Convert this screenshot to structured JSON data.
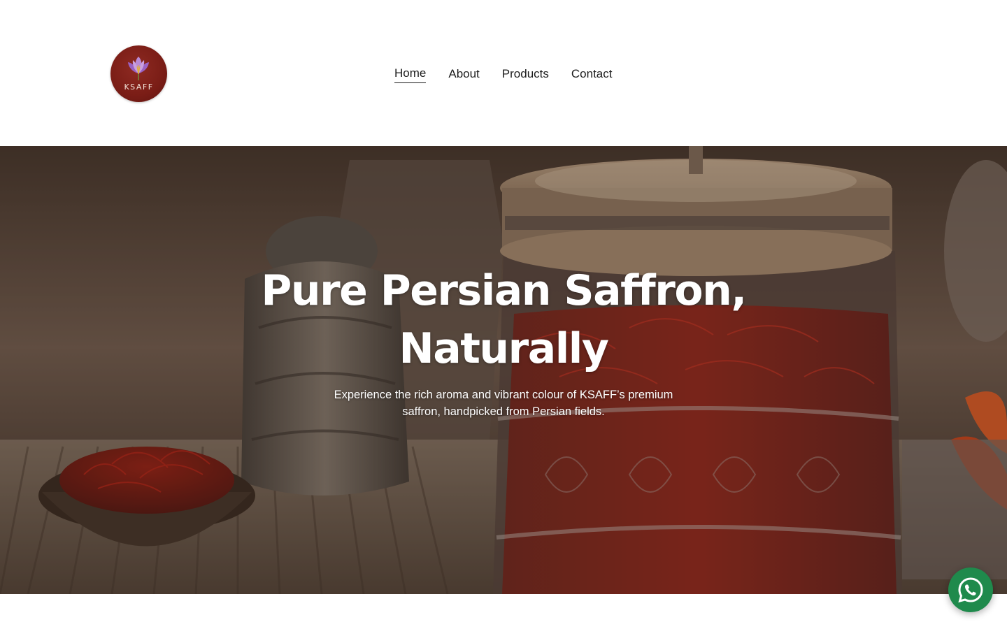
{
  "brand": {
    "logo_text": "KSAFF",
    "logo_color": "#7a1d16",
    "logo_icon": "saffron-crocus-icon"
  },
  "nav": {
    "items": [
      {
        "label": "Home",
        "active": true
      },
      {
        "label": "About",
        "active": false
      },
      {
        "label": "Products",
        "active": false
      },
      {
        "label": "Contact",
        "active": false
      }
    ]
  },
  "hero": {
    "title": "Pure Persian Saffron, Naturally",
    "subtitle": "Experience the rich aroma and vibrant colour of KSAFF’s premium saffron, handpicked from Persian fields.",
    "background": "saffron jar and bowl of saffron threads photo"
  },
  "floating": {
    "whatsapp_icon": "whatsapp-icon",
    "whatsapp_color": "#1f8a4c"
  }
}
